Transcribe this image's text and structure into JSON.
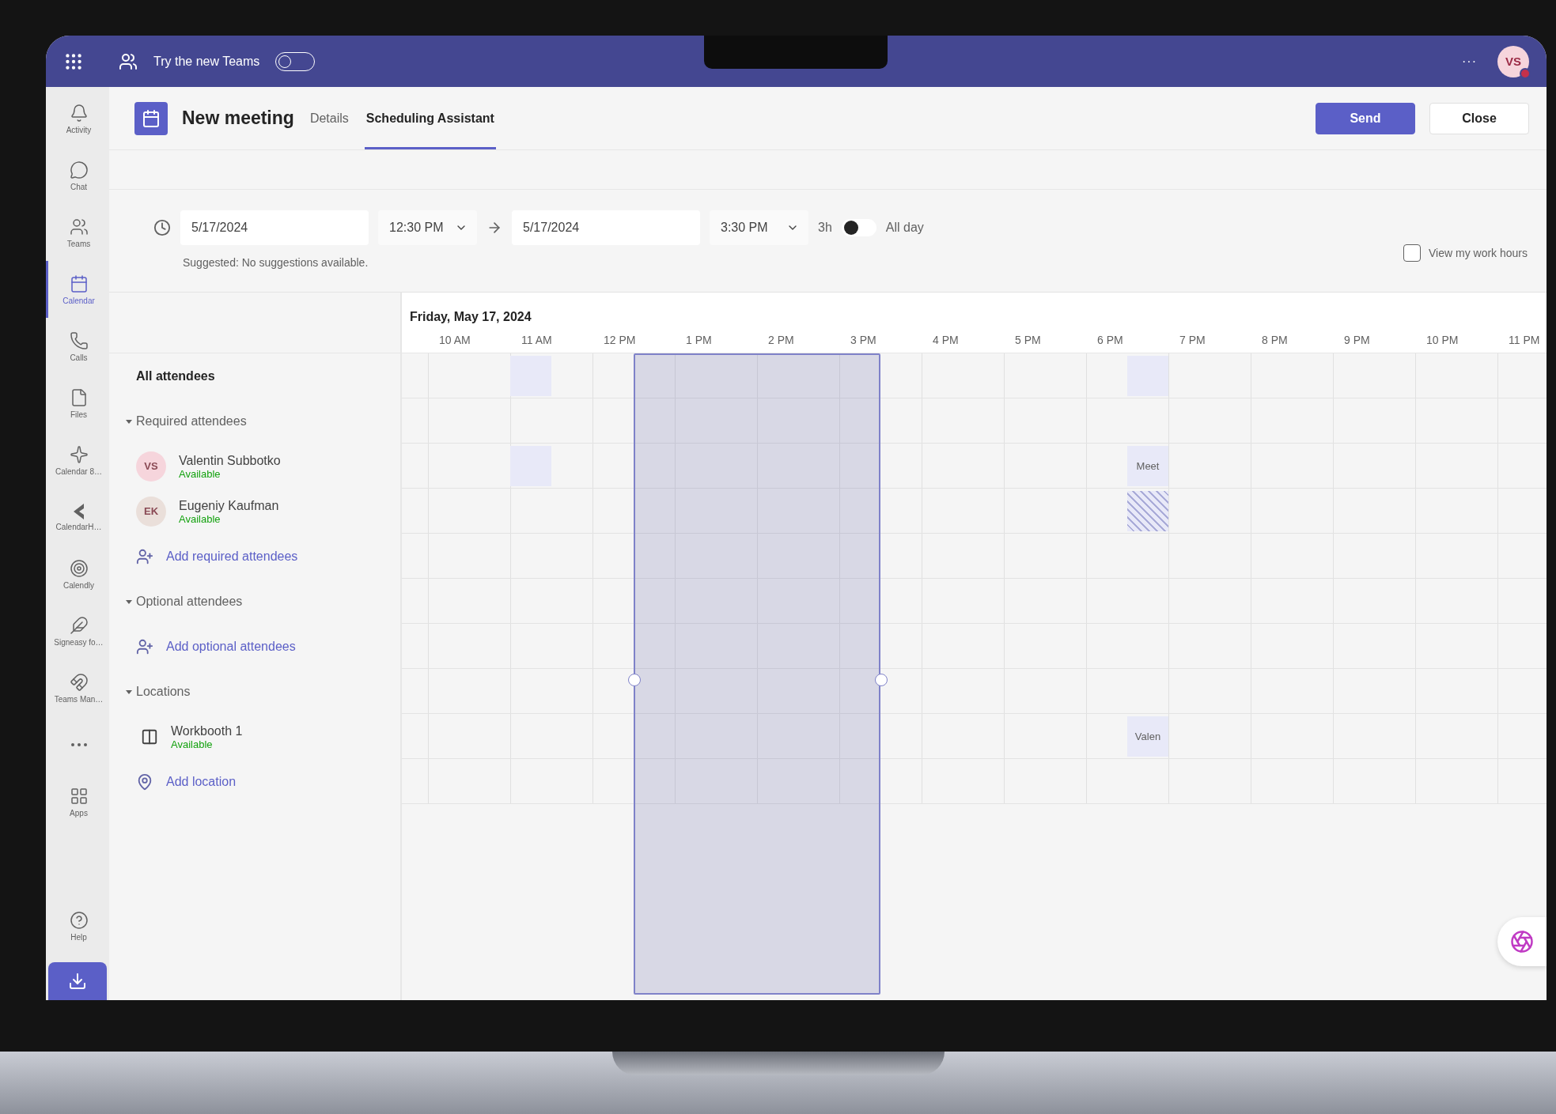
{
  "top_bar": {
    "promo": "Try the new Teams",
    "promo_toggle_on": false,
    "more": "···",
    "avatar": {
      "initials": "VS",
      "busy": true
    }
  },
  "rail": {
    "items": [
      {
        "label": "Activity",
        "selected": false
      },
      {
        "label": "Chat",
        "selected": false
      },
      {
        "label": "Teams",
        "selected": false
      },
      {
        "label": "Calendar",
        "selected": true
      },
      {
        "label": "Calls",
        "selected": false
      },
      {
        "label": "Files",
        "selected": false
      },
      {
        "label": "Calendar 8…",
        "selected": false
      },
      {
        "label": "CalendarH…",
        "selected": false
      },
      {
        "label": "Calendly",
        "selected": false
      },
      {
        "label": "Signeasy fo…",
        "selected": false
      },
      {
        "label": "Teams Man…",
        "selected": false
      },
      {
        "label": "Apps",
        "selected": false
      }
    ],
    "help": "Help"
  },
  "header": {
    "title": "New meeting",
    "tabs": [
      {
        "label": "Details",
        "selected": false
      },
      {
        "label": "Scheduling Assistant",
        "selected": true
      }
    ],
    "buttons": [
      {
        "label": "Send",
        "kind": "primary"
      },
      {
        "label": "Close",
        "kind": "secondary"
      }
    ]
  },
  "time_row": {
    "start_date": "5/17/2024",
    "start_time": "12:30 PM",
    "end_date": "5/17/2024",
    "end_time": "3:30 PM",
    "duration": "3h",
    "all_day_on": false,
    "all_day": "All day",
    "suggestion": "Suggested: No suggestions available.",
    "work_hours": {
      "label": "View my work hours",
      "checked": false
    }
  },
  "timeline": {
    "date": "Friday, May 17, 2024",
    "hours": [
      "10 AM",
      "11 AM",
      "12 PM",
      "1 PM",
      "2 PM",
      "3 PM",
      "4 PM",
      "5 PM",
      "6 PM",
      "7 PM",
      "8 PM",
      "9 PM",
      "10 PM",
      "11 PM"
    ]
  },
  "rows": [
    {
      "kind": "all",
      "label": "All attendees",
      "slots": [
        {
          "kind": "free"
        },
        {
          "kind": "free"
        },
        {
          "kind": "busy"
        },
        {
          "kind": "free"
        },
        {
          "kind": "free"
        },
        {
          "kind": "free"
        },
        {
          "kind": "free"
        },
        {
          "kind": "free"
        },
        {
          "kind": "free"
        },
        {
          "kind": "free"
        },
        {
          "kind": "free"
        },
        {
          "kind": "free"
        },
        {
          "kind": "free"
        },
        {
          "kind": "free"
        },
        {
          "kind": "free"
        },
        {
          "kind": "free"
        },
        {
          "kind": "free"
        },
        {
          "kind": "busy"
        }
      ]
    },
    {
      "kind": "section",
      "label": "Required attendees",
      "expanded": true
    },
    {
      "kind": "person",
      "initials": "VS",
      "color": "#f6d5dc",
      "name": "Valentin Subbotko",
      "status": "Available",
      "slots": [
        {
          "kind": "free"
        },
        {
          "kind": "free"
        },
        {
          "kind": "busy"
        },
        {
          "kind": "free"
        },
        {
          "kind": "free"
        },
        {
          "kind": "free"
        },
        {
          "kind": "free"
        },
        {
          "kind": "free"
        },
        {
          "kind": "free"
        },
        {
          "kind": "free"
        },
        {
          "kind": "free"
        },
        {
          "kind": "free"
        },
        {
          "kind": "free"
        },
        {
          "kind": "free"
        },
        {
          "kind": "free"
        },
        {
          "kind": "free"
        },
        {
          "kind": "free"
        },
        {
          "kind": "busy",
          "label": "Meet"
        }
      ]
    },
    {
      "kind": "person",
      "initials": "EK",
      "color": "#eadfda",
      "name": "Eugeniy Kaufman",
      "status": "Available",
      "slots": [
        {
          "kind": "free"
        },
        {
          "kind": "free"
        },
        {
          "kind": "free"
        },
        {
          "kind": "free"
        },
        {
          "kind": "free"
        },
        {
          "kind": "free"
        },
        {
          "kind": "free"
        },
        {
          "kind": "free"
        },
        {
          "kind": "free"
        },
        {
          "kind": "free"
        },
        {
          "kind": "free"
        },
        {
          "kind": "free"
        },
        {
          "kind": "free"
        },
        {
          "kind": "free"
        },
        {
          "kind": "free"
        },
        {
          "kind": "free"
        },
        {
          "kind": "free"
        },
        {
          "kind": "tentative"
        }
      ]
    },
    {
      "kind": "add",
      "label": "Add required attendees"
    },
    {
      "kind": "section",
      "label": "Optional attendees",
      "expanded": true
    },
    {
      "kind": "add",
      "label": "Add optional attendees"
    },
    {
      "kind": "section",
      "label": "Locations",
      "expanded": true
    },
    {
      "kind": "location",
      "name": "Workbooth 1",
      "status": "Available",
      "slots": [
        {
          "kind": "free"
        },
        {
          "kind": "free"
        },
        {
          "kind": "free"
        },
        {
          "kind": "free"
        },
        {
          "kind": "free"
        },
        {
          "kind": "free"
        },
        {
          "kind": "free"
        },
        {
          "kind": "free"
        },
        {
          "kind": "free"
        },
        {
          "kind": "free"
        },
        {
          "kind": "free"
        },
        {
          "kind": "free"
        },
        {
          "kind": "free"
        },
        {
          "kind": "free"
        },
        {
          "kind": "free"
        },
        {
          "kind": "free"
        },
        {
          "kind": "free"
        },
        {
          "kind": "busy",
          "label": "Valen"
        }
      ]
    },
    {
      "kind": "add-location",
      "label": "Add location"
    }
  ]
}
